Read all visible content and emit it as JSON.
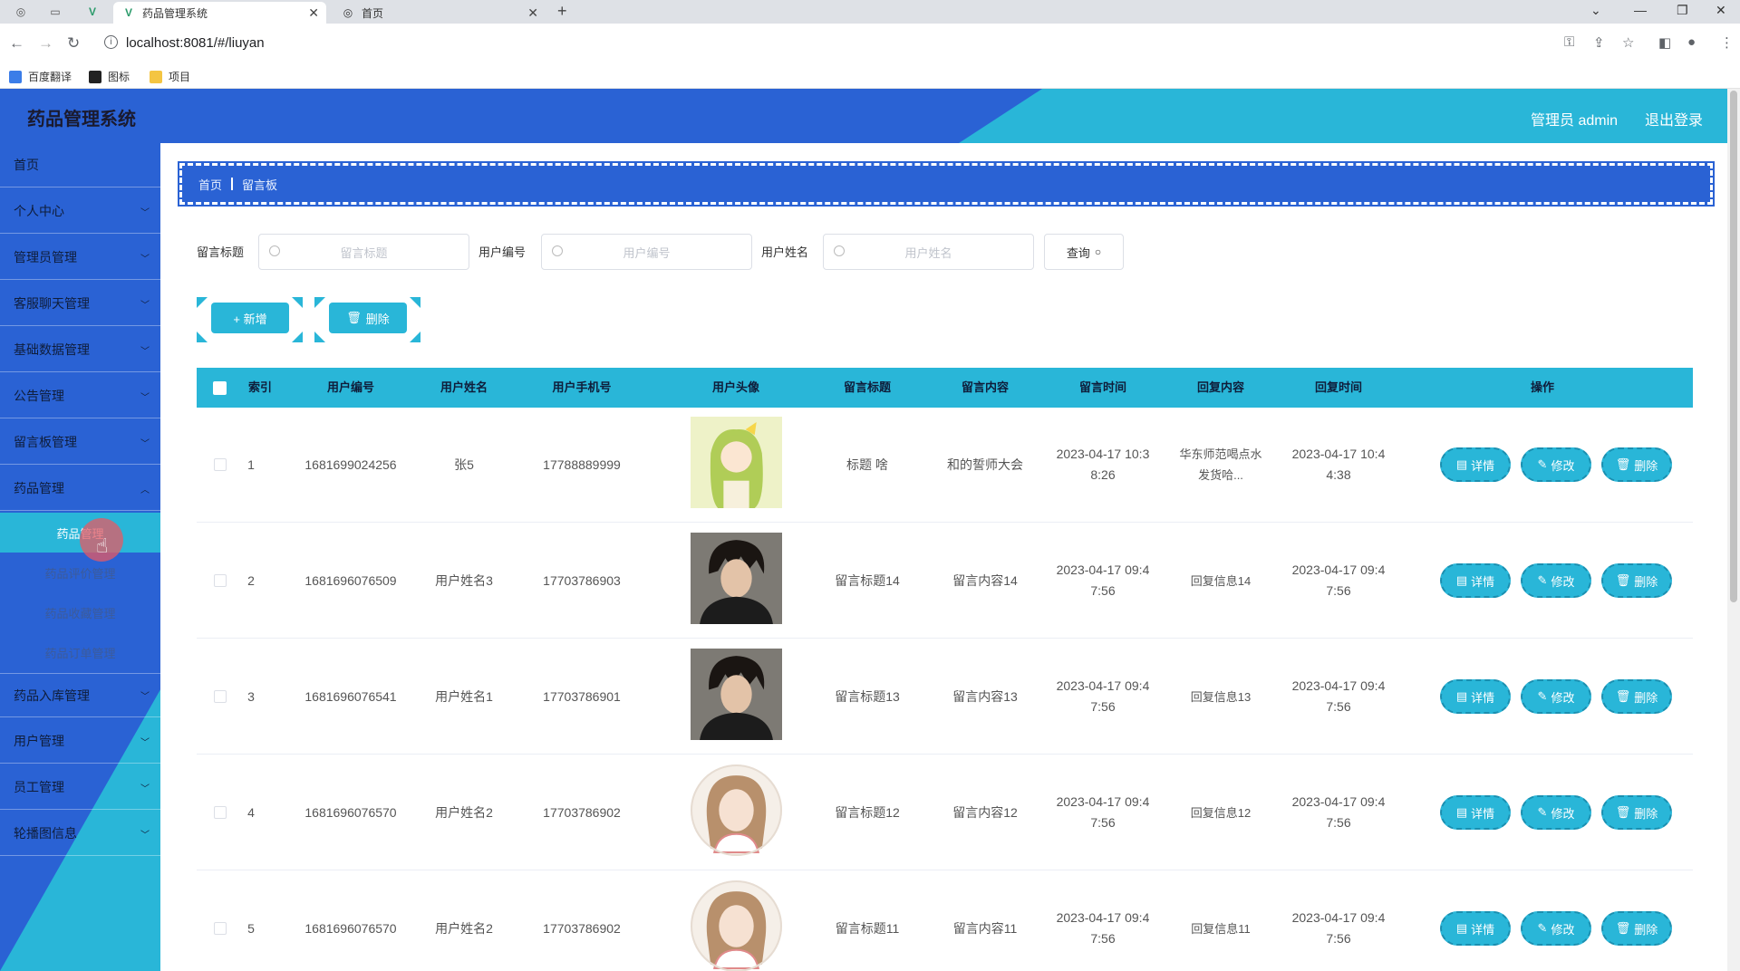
{
  "browser": {
    "tabs": [
      {
        "title": "药品管理系统",
        "active": true
      },
      {
        "title": "首页",
        "active": false
      }
    ],
    "url": "localhost:8081/#/liuyan",
    "bookmarks": [
      "百度翻译",
      "图标",
      "项目"
    ]
  },
  "header": {
    "title": "药品管理系统",
    "user": "管理员 admin",
    "logout": "退出登录",
    "colors": {
      "blue": "#2a62d4",
      "cyan": "#29b6d8"
    }
  },
  "sidebar": {
    "items": [
      {
        "label": "首页"
      },
      {
        "label": "个人中心"
      },
      {
        "label": "管理员管理"
      },
      {
        "label": "客服聊天管理"
      },
      {
        "label": "基础数据管理"
      },
      {
        "label": "公告管理"
      },
      {
        "label": "留言板管理"
      },
      {
        "label": "药品管理"
      },
      {
        "label": "药品入库管理"
      },
      {
        "label": "用户管理"
      },
      {
        "label": "员工管理"
      },
      {
        "label": "轮播图信息"
      }
    ],
    "sub_items": [
      {
        "label": "药品管理",
        "active": true
      },
      {
        "label": "药品评价管理"
      },
      {
        "label": "药品收藏管理"
      },
      {
        "label": "药品订单管理"
      }
    ]
  },
  "breadcrumb": {
    "home": "首页",
    "current": "留言板"
  },
  "search": {
    "title_label": "留言标题",
    "title_placeholder": "留言标题",
    "userno_label": "用户编号",
    "userno_placeholder": "用户编号",
    "username_label": "用户姓名",
    "username_placeholder": "用户姓名",
    "query_label": "查询"
  },
  "actions": {
    "add_label": "+ 新增",
    "delete_label": "删除"
  },
  "table": {
    "columns": [
      "索引",
      "用户编号",
      "用户姓名",
      "用户手机号",
      "用户头像",
      "留言标题",
      "留言内容",
      "留言时间",
      "回复内容",
      "回复时间",
      "操作"
    ],
    "op_labels": {
      "detail": "详情",
      "edit": "修改",
      "delete": "删除"
    },
    "rows": [
      {
        "index": "1",
        "user_no": "1681699024256",
        "user_name": "张5",
        "phone": "17788889999",
        "avatar": "anime-girl",
        "title": "标题 啥",
        "content": "和的誓师大会",
        "time_1": "2023-04-17 10:3",
        "time_2": "8:26",
        "reply_1": "华东师范喝点水",
        "reply_2": "发货哈...",
        "reply_time_1": "2023-04-17 10:4",
        "reply_time_2": "4:38"
      },
      {
        "index": "2",
        "user_no": "1681696076509",
        "user_name": "用户姓名3",
        "phone": "17703786903",
        "avatar": "dark-hair-man",
        "title": "留言标题14",
        "content": "留言内容14",
        "time_1": "2023-04-17 09:4",
        "time_2": "7:56",
        "reply_1": "回复信息14",
        "reply_2": "",
        "reply_time_1": "2023-04-17 09:4",
        "reply_time_2": "7:56"
      },
      {
        "index": "3",
        "user_no": "1681696076541",
        "user_name": "用户姓名1",
        "phone": "17703786901",
        "avatar": "dark-hair-man",
        "title": "留言标题13",
        "content": "留言内容13",
        "time_1": "2023-04-17 09:4",
        "time_2": "7:56",
        "reply_1": "回复信息13",
        "reply_2": "",
        "reply_time_1": "2023-04-17 09:4",
        "reply_time_2": "7:56"
      },
      {
        "index": "4",
        "user_no": "1681696076570",
        "user_name": "用户姓名2",
        "phone": "17703786902",
        "avatar": "illustrated-girl",
        "title": "留言标题12",
        "content": "留言内容12",
        "time_1": "2023-04-17 09:4",
        "time_2": "7:56",
        "reply_1": "回复信息12",
        "reply_2": "",
        "reply_time_1": "2023-04-17 09:4",
        "reply_time_2": "7:56"
      },
      {
        "index": "5",
        "user_no": "1681696076570",
        "user_name": "用户姓名2",
        "phone": "17703786902",
        "avatar": "illustrated-girl",
        "title": "留言标题11",
        "content": "留言内容11",
        "time_1": "2023-04-17 09:4",
        "time_2": "7:56",
        "reply_1": "回复信息11",
        "reply_2": "",
        "reply_time_1": "2023-04-17 09:4",
        "reply_time_2": "7:56"
      }
    ]
  }
}
